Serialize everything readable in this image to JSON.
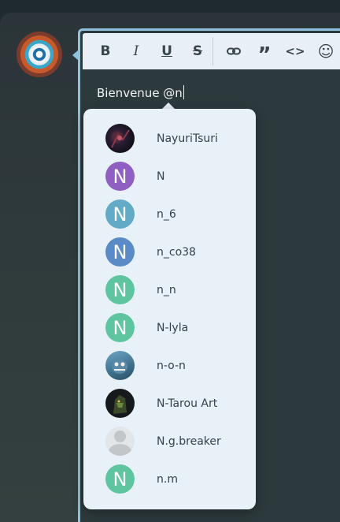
{
  "toolbar": {
    "bold": {
      "glyph": "B",
      "icon": "bold-icon"
    },
    "italic": {
      "glyph": "I",
      "icon": "italic-icon"
    },
    "underline": {
      "glyph": "U",
      "icon": "underline-icon"
    },
    "strike": {
      "glyph": "S",
      "icon": "strikethrough-icon"
    },
    "link": {
      "icon": "link-icon"
    },
    "quote": {
      "glyph": "”",
      "icon": "quote-icon"
    },
    "code": {
      "glyph": "<>",
      "icon": "code-icon"
    },
    "emoji": {
      "glyph": "☺",
      "icon": "emoji-icon"
    }
  },
  "editor": {
    "text": "Bienvenue @n"
  },
  "mentions": [
    {
      "name": "NayuriTsuri",
      "initial": "",
      "avatar": "image",
      "color": "#1c1a24"
    },
    {
      "name": "N",
      "initial": "N",
      "avatar": "letter",
      "color": "#8f5fc1"
    },
    {
      "name": "n_6",
      "initial": "N",
      "avatar": "letter",
      "color": "#63aac6"
    },
    {
      "name": "n_co38",
      "initial": "N",
      "avatar": "letter",
      "color": "#5b8bc6"
    },
    {
      "name": "n_n",
      "initial": "N",
      "avatar": "letter",
      "color": "#5fc5a0"
    },
    {
      "name": "N-lyla",
      "initial": "N",
      "avatar": "letter",
      "color": "#5fc5a0"
    },
    {
      "name": "n-o-n",
      "initial": "",
      "avatar": "image",
      "color": "#4a7e9a"
    },
    {
      "name": "N-Tarou Art",
      "initial": "",
      "avatar": "image",
      "color": "#161a1d"
    },
    {
      "name": "N.g.breaker",
      "initial": "",
      "avatar": "placeholder",
      "color": "#e3e6e8"
    },
    {
      "name": "n.m",
      "initial": "N",
      "avatar": "letter",
      "color": "#5fc5a0"
    }
  ],
  "colors": {
    "accent": "#8fc2dc",
    "popup_bg": "#e8f1f8",
    "text_dark": "#34424a"
  }
}
